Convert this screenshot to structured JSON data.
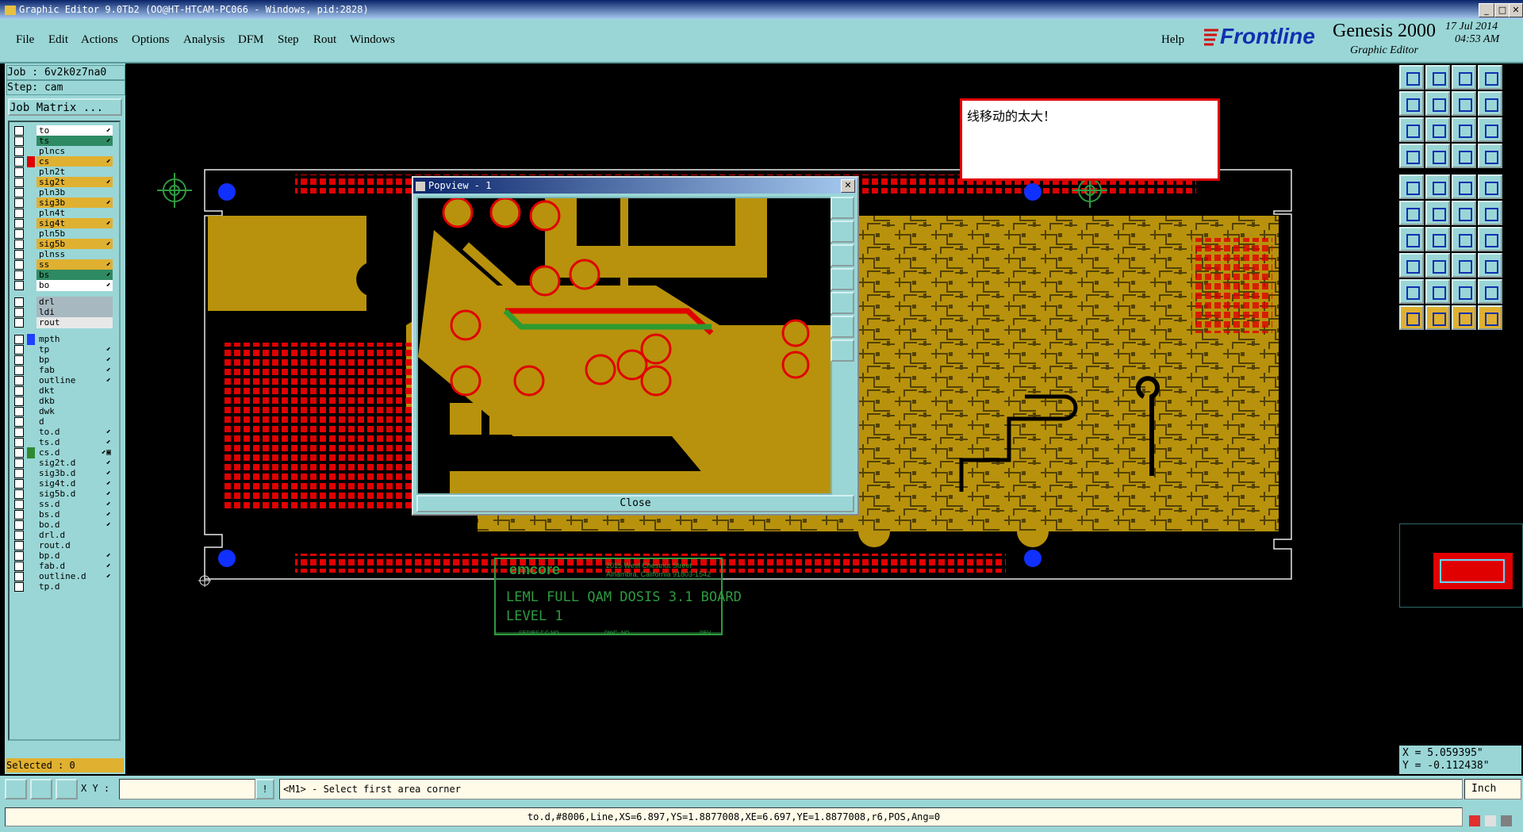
{
  "window": {
    "title": "Graphic Editor 9.0Tb2 (OO@HT-HTCAM-PC066 - Windows, pid:2828)",
    "min": "_",
    "max": "□",
    "close": "✕"
  },
  "menu": [
    "File",
    "Edit",
    "Actions",
    "Options",
    "Analysis",
    "DFM",
    "Step",
    "Rout",
    "Windows"
  ],
  "help": "Help",
  "brand": {
    "logo": "Frontline",
    "product": "Genesis 2000",
    "subtitle": "Graphic Editor",
    "date": "17 Jul 2014",
    "time": "04:53 AM"
  },
  "job": {
    "label": "Job : 6v2k0z7na0",
    "step": "Step: cam",
    "matrix": "Job Matrix ..."
  },
  "layers": [
    {
      "name": "to",
      "bg": "#ffffff",
      "sw": "",
      "flag": "⬋"
    },
    {
      "name": "ts",
      "bg": "#2e8a62",
      "sw": "",
      "flag": "⬋"
    },
    {
      "name": "plncs",
      "bg": "#9ad6d6",
      "sw": "",
      "flag": ""
    },
    {
      "name": "cs",
      "bg": "#e0b030",
      "sw": "#e00000",
      "flag": "⬋"
    },
    {
      "name": "pln2t",
      "bg": "#9ad6d6",
      "sw": "",
      "flag": ""
    },
    {
      "name": "sig2t",
      "bg": "#e0b030",
      "sw": "",
      "flag": "⬋"
    },
    {
      "name": "pln3b",
      "bg": "#9ad6d6",
      "sw": "",
      "flag": ""
    },
    {
      "name": "sig3b",
      "bg": "#e0b030",
      "sw": "",
      "flag": "⬋"
    },
    {
      "name": "pln4t",
      "bg": "#9ad6d6",
      "sw": "",
      "flag": ""
    },
    {
      "name": "sig4t",
      "bg": "#e0b030",
      "sw": "",
      "flag": "⬋"
    },
    {
      "name": "pln5b",
      "bg": "#9ad6d6",
      "sw": "",
      "flag": ""
    },
    {
      "name": "sig5b",
      "bg": "#e0b030",
      "sw": "",
      "flag": "⬋"
    },
    {
      "name": "plnss",
      "bg": "#9ad6d6",
      "sw": "",
      "flag": ""
    },
    {
      "name": "ss",
      "bg": "#e0b030",
      "sw": "",
      "flag": "⬋"
    },
    {
      "name": "bs",
      "bg": "#2e8a62",
      "sw": "",
      "flag": "⬋"
    },
    {
      "name": "bo",
      "bg": "#ffffff",
      "sw": "",
      "flag": "⬋"
    },
    {
      "name": "drl",
      "bg": "#a8b8c0",
      "sw": "",
      "flag": ""
    },
    {
      "name": "ldi",
      "bg": "#a8b8c0",
      "sw": "",
      "flag": ""
    },
    {
      "name": "rout",
      "bg": "#e8e8e8",
      "sw": "",
      "flag": ""
    },
    {
      "name": "mpth",
      "bg": "#9ad6d6",
      "sw": "#2040ff",
      "flag": ""
    },
    {
      "name": "tp",
      "bg": "#9ad6d6",
      "sw": "",
      "flag": "⬋"
    },
    {
      "name": "bp",
      "bg": "#9ad6d6",
      "sw": "",
      "flag": "⬋"
    },
    {
      "name": "fab",
      "bg": "#9ad6d6",
      "sw": "",
      "flag": "⬋"
    },
    {
      "name": "outline",
      "bg": "#9ad6d6",
      "sw": "",
      "flag": "⬋"
    },
    {
      "name": "dkt",
      "bg": "#9ad6d6",
      "sw": "",
      "flag": ""
    },
    {
      "name": "dkb",
      "bg": "#9ad6d6",
      "sw": "",
      "flag": ""
    },
    {
      "name": "dwk",
      "bg": "#9ad6d6",
      "sw": "",
      "flag": ""
    },
    {
      "name": "d",
      "bg": "#9ad6d6",
      "sw": "",
      "flag": ""
    },
    {
      "name": "to.d",
      "bg": "#9ad6d6",
      "sw": "",
      "flag": "⬋"
    },
    {
      "name": "ts.d",
      "bg": "#9ad6d6",
      "sw": "",
      "flag": "⬋"
    },
    {
      "name": "cs.d",
      "bg": "#9ad6d6",
      "sw": "#2e8a30",
      "flag": "⬋▣"
    },
    {
      "name": "sig2t.d",
      "bg": "#9ad6d6",
      "sw": "",
      "flag": "⬋"
    },
    {
      "name": "sig3b.d",
      "bg": "#9ad6d6",
      "sw": "",
      "flag": "⬋"
    },
    {
      "name": "sig4t.d",
      "bg": "#9ad6d6",
      "sw": "",
      "flag": "⬋"
    },
    {
      "name": "sig5b.d",
      "bg": "#9ad6d6",
      "sw": "",
      "flag": "⬋"
    },
    {
      "name": "ss.d",
      "bg": "#9ad6d6",
      "sw": "",
      "flag": "⬋"
    },
    {
      "name": "bs.d",
      "bg": "#9ad6d6",
      "sw": "",
      "flag": "⬋"
    },
    {
      "name": "bo.d",
      "bg": "#9ad6d6",
      "sw": "",
      "flag": "⬋"
    },
    {
      "name": "drl.d",
      "bg": "#9ad6d6",
      "sw": "",
      "flag": ""
    },
    {
      "name": "rout.d",
      "bg": "#9ad6d6",
      "sw": "",
      "flag": ""
    },
    {
      "name": "bp.d",
      "bg": "#9ad6d6",
      "sw": "",
      "flag": "⬋"
    },
    {
      "name": "fab.d",
      "bg": "#9ad6d6",
      "sw": "",
      "flag": "⬋"
    },
    {
      "name": "outline.d",
      "bg": "#9ad6d6",
      "sw": "",
      "flag": "⬋"
    },
    {
      "name": "tp.d",
      "bg": "#9ad6d6",
      "sw": "",
      "flag": ""
    }
  ],
  "selected": "Selected : 0",
  "note": "线移动的太大！",
  "popview": {
    "title": "Popview - 1",
    "close": "Close"
  },
  "board": {
    "company": "emcore",
    "address1": "2015 West Chestnut Street",
    "address2": "Alhambra, California 91803-1542",
    "title1": "LEML FULL QAM DOSIS 3.1 BOARD",
    "title2": "LEVEL 1",
    "foot1": "SERIES F.C.NO.",
    "foot2": "DWG. NO.",
    "foot3": "REV."
  },
  "coords": {
    "x": "X = 5.059395\"",
    "y": "Y = -0.112438\""
  },
  "cmd": {
    "xy_label": "X Y :",
    "xy_value": "",
    "prompt": "<M1> - Select first area corner",
    "units": "Inch"
  },
  "status": "to.d,#8006,Line,XS=6.897,YS=1.8877008,XE=6.697,YE=1.8877008,r6,POS,Ang=0",
  "colors": {
    "panel": "#9ad6d6",
    "copper": "#b8920c",
    "pad": "#e00000",
    "accent": "#e0b030"
  }
}
